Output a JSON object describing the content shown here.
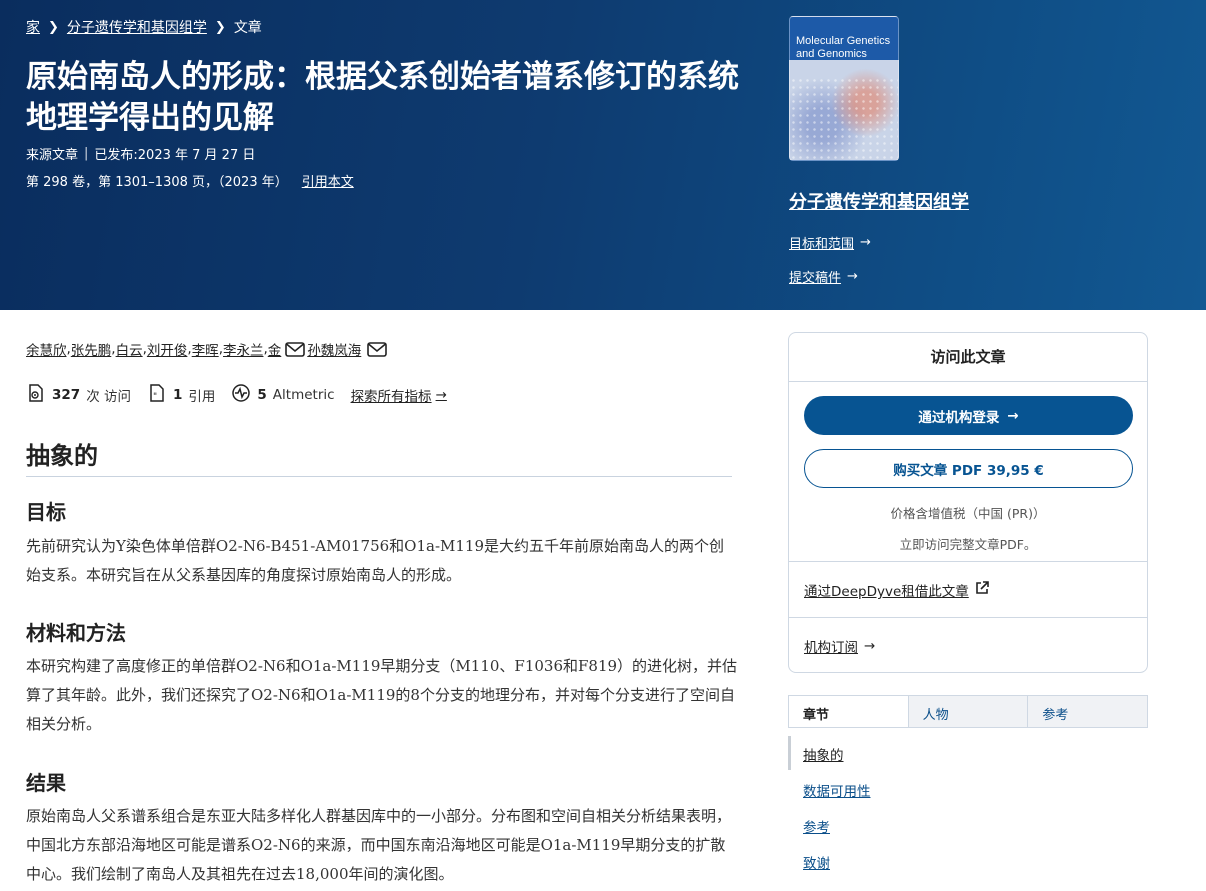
{
  "breadcrumb": {
    "home": "家",
    "journal": "分子遗传学和基因组学",
    "current": "文章"
  },
  "article": {
    "title": "原始南岛人的形成：根据父系创始者谱系修订的系统地理学得出的见解",
    "type": "来源文章",
    "published": "已发布:2023 年 7 月 27 日",
    "citation": "第 298 卷，第 1301–1308 页，（2023 年）",
    "cite_link": "引用本文"
  },
  "journal": {
    "cover_title": "Molecular Genetics and Genomics",
    "name": "分子遗传学和基因组学",
    "aims_link": "目标和范围",
    "submit_link": "提交稿件"
  },
  "authors": [
    "余慧欣",
    "张先鹏",
    "白云",
    "刘开俊",
    "李晖",
    "李永兰",
    "金",
    "孙魏岚海"
  ],
  "metrics": {
    "accesses_count": "327",
    "accesses_label": "次 访问",
    "citations_count": "1",
    "citations_label": "引用",
    "altmetric_count": "5",
    "altmetric_label": "Altmetric",
    "explore_link": "探索所有指标"
  },
  "abstract": {
    "heading": "抽象的",
    "sections": [
      {
        "heading": "目标",
        "text": "先前研究认为Y染色体单倍群O2-N6-B451-AM01756和O1a-M119是大约五千年前原始南岛人的两个创始支系。本研究旨在从父系基因库的角度探讨原始南岛人的形成。"
      },
      {
        "heading": "材料和方法",
        "text": "本研究构建了高度修正的单倍群O2-N6和O1a-M119早期分支（M110、F1036和F819）的进化树，并估算了其年龄。此外，我们还探究了O2-N6和O1a-M119的8个分支的地理分布，并对每个分支进行了空间自相关分析。"
      },
      {
        "heading": "结果",
        "text": "原始南岛人父系谱系组合是东亚大陆多样化人群基因库中的一小部分。分布图和空间自相关分析结果表明，中国北方东部沿海地区可能是谱系O2-N6的来源，而中国东南沿海地区可能是O1a-M119早期分支的扩散中心。我们绘制了南岛人及其祖先在过去18,000年间的演化图。"
      }
    ]
  },
  "access": {
    "heading": "访问此文章",
    "institution_button": "通过机构登录",
    "buy_button": "购买文章 PDF 39,95 €",
    "price_note": "价格含增值税（中国 (PR)）",
    "instant_note": "立即访问完整文章PDF。",
    "deepdyve_link": "通过DeepDyve租借此文章",
    "subscription_link": "机构订阅"
  },
  "tabs": [
    "章节",
    "人物",
    "参考"
  ],
  "toc": [
    "抽象的",
    "数据可用性",
    "参考",
    "致谢"
  ],
  "colors": {
    "hero_bg": "#0e3b70",
    "primary_button": "#075492",
    "link": "#0b4f8a"
  }
}
